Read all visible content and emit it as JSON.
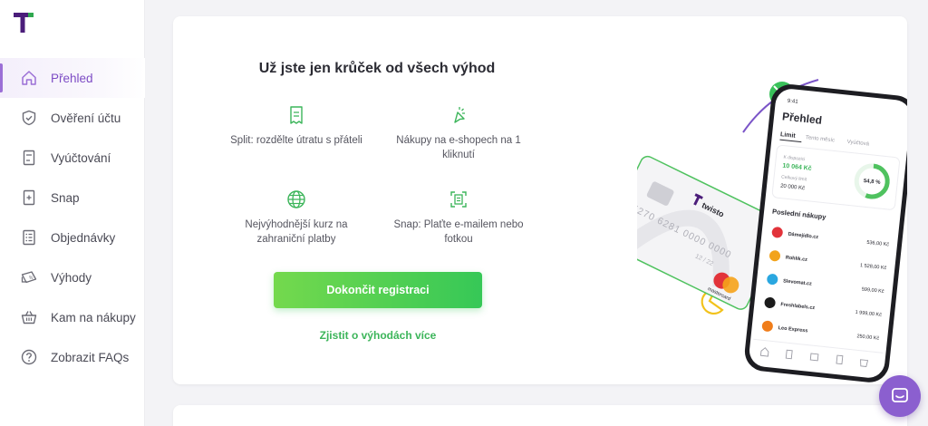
{
  "brand": {
    "logo_icon": "twisto-logo",
    "accent": "#9b6fd6",
    "logo_color": "#4b1d7a",
    "logo_accent": "#2fa84f"
  },
  "sidebar": {
    "items": [
      {
        "label": "Přehled",
        "icon": "home-icon",
        "active": true
      },
      {
        "label": "Ověření účtu",
        "icon": "shield-check-icon"
      },
      {
        "label": "Vyúčtování",
        "icon": "bill-icon"
      },
      {
        "label": "Snap",
        "icon": "snap-plus-icon"
      },
      {
        "label": "Objednávky",
        "icon": "orders-list-icon"
      },
      {
        "label": "Výhody",
        "icon": "ticket-percent-icon"
      },
      {
        "label": "Kam na nákupy",
        "icon": "basket-icon"
      },
      {
        "label": "Zobrazit FAQs",
        "icon": "help-icon"
      }
    ]
  },
  "main": {
    "headline": "Už jste jen krůček od všech výhod",
    "features": [
      {
        "text": "Split: rozdělte útratu s přáteli",
        "icon": "receipt-icon"
      },
      {
        "text": "Nákupy na e-shopech na 1 kliknutí",
        "icon": "click-cursor-icon"
      },
      {
        "text": "Nejvýhodnější kurz na zahraniční platby",
        "icon": "globe-icon"
      },
      {
        "text": "Snap: Plaťte e-mailem nebo fotkou",
        "icon": "scan-icon"
      }
    ],
    "cta_label": "Dokončit registraci",
    "more_link": "Zjistit o výhodách více",
    "cta_gradient": [
      "#74d94d",
      "#36c857"
    ]
  },
  "illustration": {
    "card": {
      "brand_text": "twisto",
      "number_line1": "5270 6281 0000 0000",
      "expiry": "12 / 22",
      "network": "mastercard"
    },
    "phone": {
      "status_time": "9:41",
      "title": "Přehled",
      "tabs": [
        "Limit",
        "Tento měsíc",
        "Vyúčtová"
      ],
      "available_label": "K dispozici",
      "available_value": "10 064 Kč",
      "limit_label": "Celkový limit",
      "limit_value": "20 000 Kč",
      "ring_percent_label": "54,8 %",
      "ring_percent": 54.8,
      "purchases_title": "Poslední nákupy",
      "purchases": [
        {
          "merchant": "Dámejídlo.cz",
          "amount": "536,00 Kč",
          "color": "#e2333a"
        },
        {
          "merchant": "Rohlik.cz",
          "amount": "1 528,00 Kč",
          "color": "#f2a31b"
        },
        {
          "merchant": "Slevomat.cz",
          "amount": "599,00 Kč",
          "color": "#2aa7e0"
        },
        {
          "merchant": "Freshlabels.cz",
          "amount": "1 999,00 Kč",
          "color": "#1b1b1b"
        },
        {
          "merchant": "Leo Express",
          "amount": "250,00 Kč",
          "color": "#f07d1a"
        }
      ]
    }
  },
  "chat": {
    "icon": "chat-bubble-icon"
  }
}
